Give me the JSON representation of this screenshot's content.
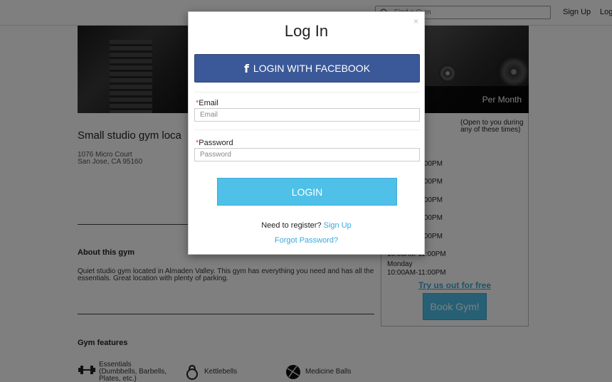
{
  "header": {
    "search_placeholder": "Find a Gym",
    "signup_label": "Sign Up",
    "login_label": "Log"
  },
  "gym": {
    "title": "Small studio gym loca",
    "address_line1": "1076 Micro Court",
    "address_line2": "San Jose, CA 95160",
    "per_month_label": "Per Month",
    "about_title": "About this gym",
    "about_text": "Quiet studio gym located in Almaden Valley. This gym has everything you need and has all the essentials. Great location with plenty of parking.",
    "features_title": "Gym features",
    "features": [
      {
        "label": "Essentials (Dumbbells, Barbells, Plates, etc.)",
        "icon": "dumbbell-icon"
      },
      {
        "label": "Kettlebells",
        "icon": "kettlebell-icon"
      },
      {
        "label": "Medicine Balls",
        "icon": "medicine-ball-icon"
      }
    ]
  },
  "sidebar": {
    "open_note": "(Open to you during any of these times)",
    "hours": [
      ":00PM",
      ":00PM",
      ":00PM",
      ":00PM",
      ":00PM",
      "10:00AM-11:00PM",
      "Monday",
      "10:00AM-11:00PM"
    ],
    "try_free": "Try us out for free",
    "book_label": "Book Gym!"
  },
  "modal": {
    "close_glyph": "×",
    "title": "Log In",
    "facebook_label": "LOGIN WITH FACEBOOK",
    "email_label": "Email",
    "email_placeholder": "Email",
    "password_label": "Password",
    "password_placeholder": "Password",
    "required_mark": "*",
    "login_label": "LOGIN",
    "register_text": "Need to register?",
    "register_link": "Sign Up",
    "forgot_label": "Forgot Password?",
    "colors": {
      "facebook": "#3b5998",
      "accent": "#4fc1e9",
      "link": "#3aa9d8"
    }
  }
}
